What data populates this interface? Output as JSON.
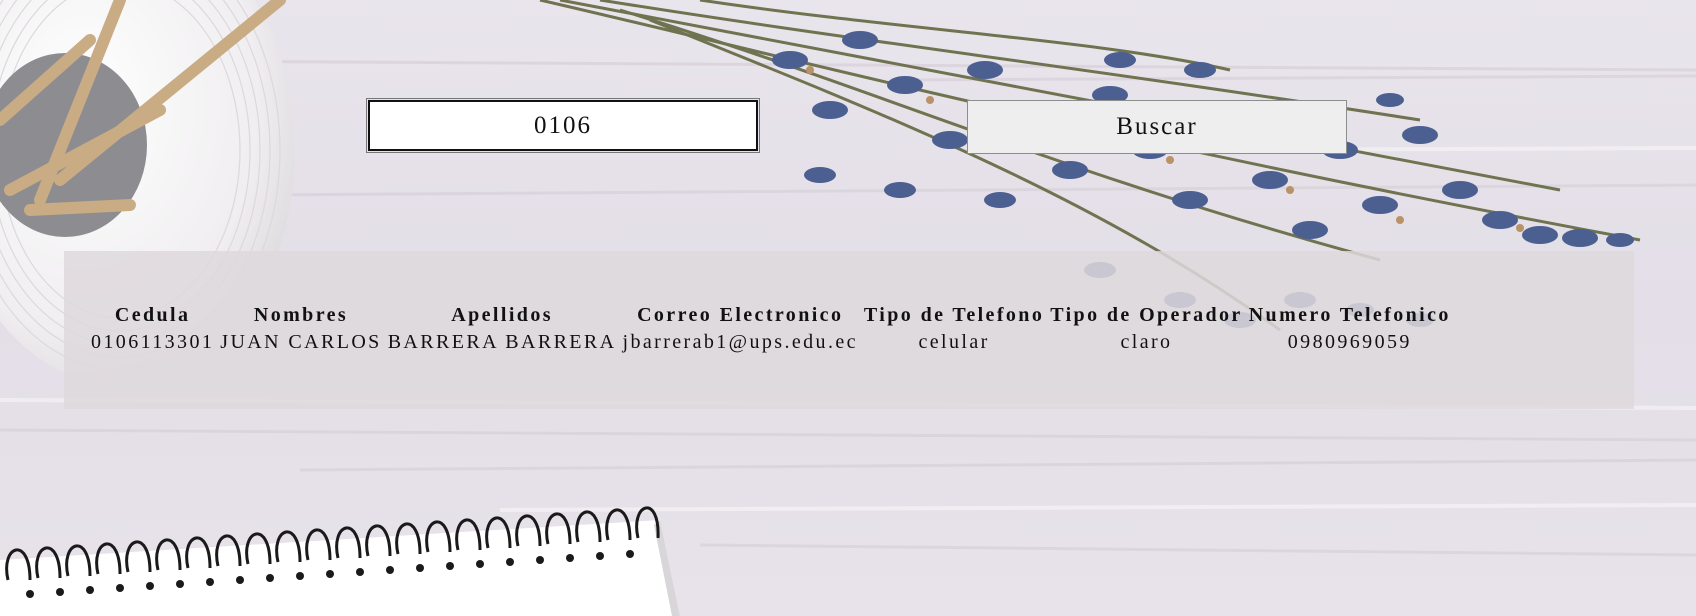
{
  "search": {
    "value": "0106",
    "button_label": "Buscar"
  },
  "table": {
    "headers": [
      "Cedula",
      "Nombres",
      "Apellidos",
      "Correo Electronico",
      "Tipo de Telefono",
      "Tipo de Operador",
      "Numero Telefonico"
    ],
    "rows": [
      [
        "0106113301",
        "JUAN CARLOS",
        "BARRERA BARRERA",
        "jbarrerab1@ups.edu.ec",
        "celular",
        "claro",
        "0980969059"
      ]
    ]
  }
}
